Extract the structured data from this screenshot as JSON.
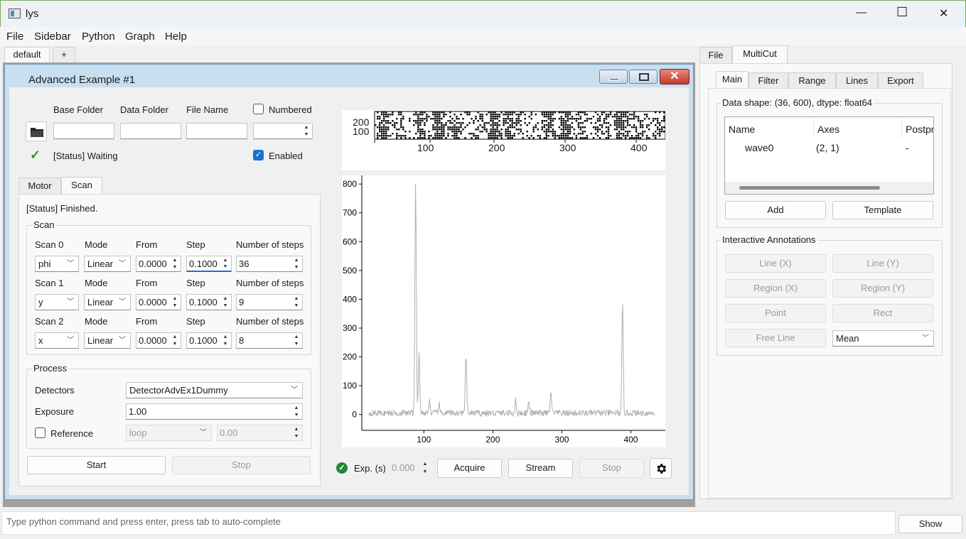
{
  "window": {
    "title": "lys",
    "minimize": "—",
    "maximize": "☐",
    "close": "✕"
  },
  "menu": [
    "File",
    "Sidebar",
    "Python",
    "Graph",
    "Help"
  ],
  "workspace_tabs": {
    "default": "default",
    "add": "+"
  },
  "subwindow": {
    "title": "Advanced Example #1"
  },
  "folder": {
    "base_label": "Base Folder",
    "data_label": "Data Folder",
    "file_label": "File Name",
    "numbered_label": "Numbered",
    "enabled_label": "Enabled",
    "status": "[Status] Waiting"
  },
  "scan_tabs": [
    "Motor",
    "Scan"
  ],
  "scan_status": "[Status] Finished.",
  "scan_group": "Scan",
  "scan_rows": [
    {
      "label": "Scan 0",
      "mode_label": "Mode",
      "from_label": "From",
      "step_label": "Step",
      "n_label": "Number of steps",
      "axis": "phi",
      "mode": "Linear",
      "from": "0.0000",
      "step": "0.1000",
      "n": "36"
    },
    {
      "label": "Scan 1",
      "mode_label": "Mode",
      "from_label": "From",
      "step_label": "Step",
      "n_label": "Number of steps",
      "axis": "y",
      "mode": "Linear",
      "from": "0.0000",
      "step": "0.1000",
      "n": "9"
    },
    {
      "label": "Scan 2",
      "mode_label": "Mode",
      "from_label": "From",
      "step_label": "Step",
      "n_label": "Number of steps",
      "axis": "x",
      "mode": "Linear",
      "from": "0.0000",
      "step": "0.1000",
      "n": "8"
    }
  ],
  "process": {
    "title": "Process",
    "detectors_label": "Detectors",
    "detector": "DetectorAdvEx1Dummy",
    "exposure_label": "Exposure",
    "exposure": "1.00",
    "reference_label": "Reference",
    "reference_mode": "loop",
    "reference_value": "0.00"
  },
  "buttons": {
    "start": "Start",
    "stop": "Stop"
  },
  "acquire_bar": {
    "exp_label": "Exp. (s)",
    "exp_value": "0.000",
    "acquire": "Acquire",
    "stream": "Stream",
    "stop": "Stop"
  },
  "image_plot": {
    "yticks": [
      "200",
      "100"
    ],
    "xticks": [
      "100",
      "200",
      "300",
      "400"
    ]
  },
  "chart_data": {
    "type": "line",
    "x_ticks": [
      100,
      200,
      300,
      400
    ],
    "y_ticks": [
      0,
      100,
      200,
      300,
      400,
      500,
      600,
      700,
      800
    ],
    "xlim": [
      10,
      450
    ],
    "ylim": [
      -55,
      830
    ],
    "line_color": "#b0b0b0",
    "peaks": [
      {
        "x": 88,
        "y": 800
      },
      {
        "x": 93,
        "y": 210
      },
      {
        "x": 108,
        "y": 45
      },
      {
        "x": 122,
        "y": 30
      },
      {
        "x": 161,
        "y": 205
      },
      {
        "x": 233,
        "y": 45
      },
      {
        "x": 252,
        "y": 40
      },
      {
        "x": 284,
        "y": 70
      },
      {
        "x": 388,
        "y": 380
      }
    ],
    "baseline": 5,
    "x_start": 20,
    "x_end": 435
  },
  "side_tabs": [
    "File",
    "MultiCut"
  ],
  "multicut_tabs": [
    "Main",
    "Filter",
    "Range",
    "Lines",
    "Export"
  ],
  "data_shape": "Data shape: (36, 600), dtype: float64",
  "table": {
    "headers": [
      "Name",
      "Axes",
      "Postpr"
    ],
    "rows": [
      [
        "wave0",
        "(2, 1)",
        "-"
      ]
    ]
  },
  "multicut_buttons": {
    "add": "Add",
    "template": "Template"
  },
  "annotations": {
    "title": "Interactive Annotations",
    "line_x": "Line (X)",
    "line_y": "Line (Y)",
    "region_x": "Region (X)",
    "region_y": "Region (Y)",
    "point": "Point",
    "rect": "Rect",
    "free_line": "Free Line",
    "mean": "Mean"
  },
  "console": {
    "placeholder": "Type python command and press enter, press tab to auto-complete",
    "show": "Show"
  }
}
